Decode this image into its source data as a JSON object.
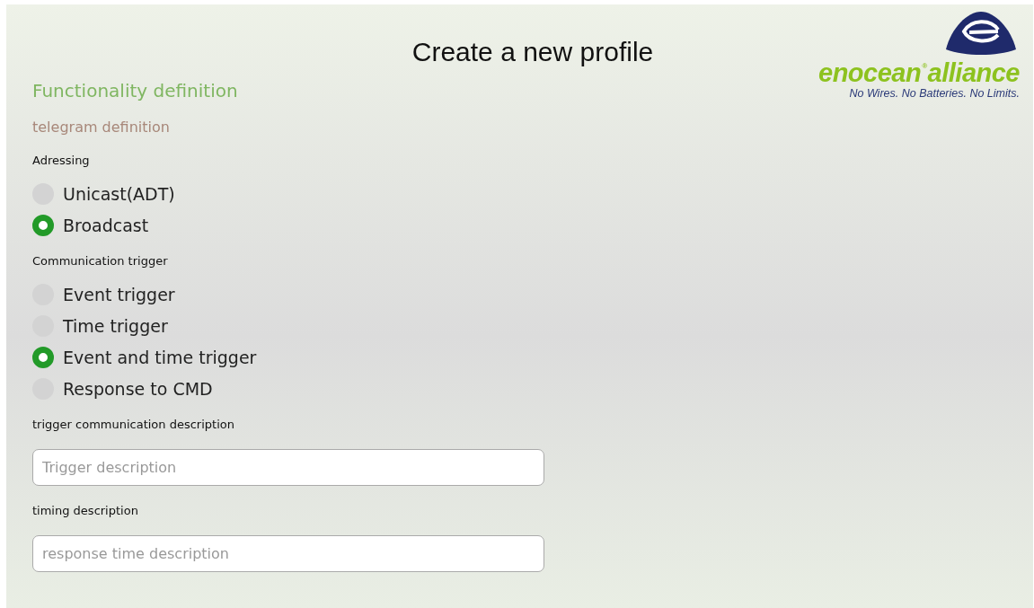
{
  "title": "Create a new profile",
  "logo": {
    "word_1": "enocean",
    "mark": "®",
    "word_2": "alliance",
    "tagline": "No Wires. No Batteries. No Limits."
  },
  "section": "Functionality definition",
  "subsection": "telegram definition",
  "groups": [
    {
      "label": "Adressing",
      "options": [
        {
          "label": "Unicast(ADT)",
          "selected": false
        },
        {
          "label": "Broadcast",
          "selected": true
        }
      ]
    },
    {
      "label": "Communication trigger",
      "options": [
        {
          "label": "Event trigger",
          "selected": false
        },
        {
          "label": "Time trigger",
          "selected": false
        },
        {
          "label": "Event and time trigger",
          "selected": true
        },
        {
          "label": "Response to CMD",
          "selected": false
        }
      ]
    }
  ],
  "fields": [
    {
      "label": "trigger communication description",
      "placeholder": "Trigger description"
    },
    {
      "label": "timing description",
      "placeholder": "response time description"
    }
  ]
}
